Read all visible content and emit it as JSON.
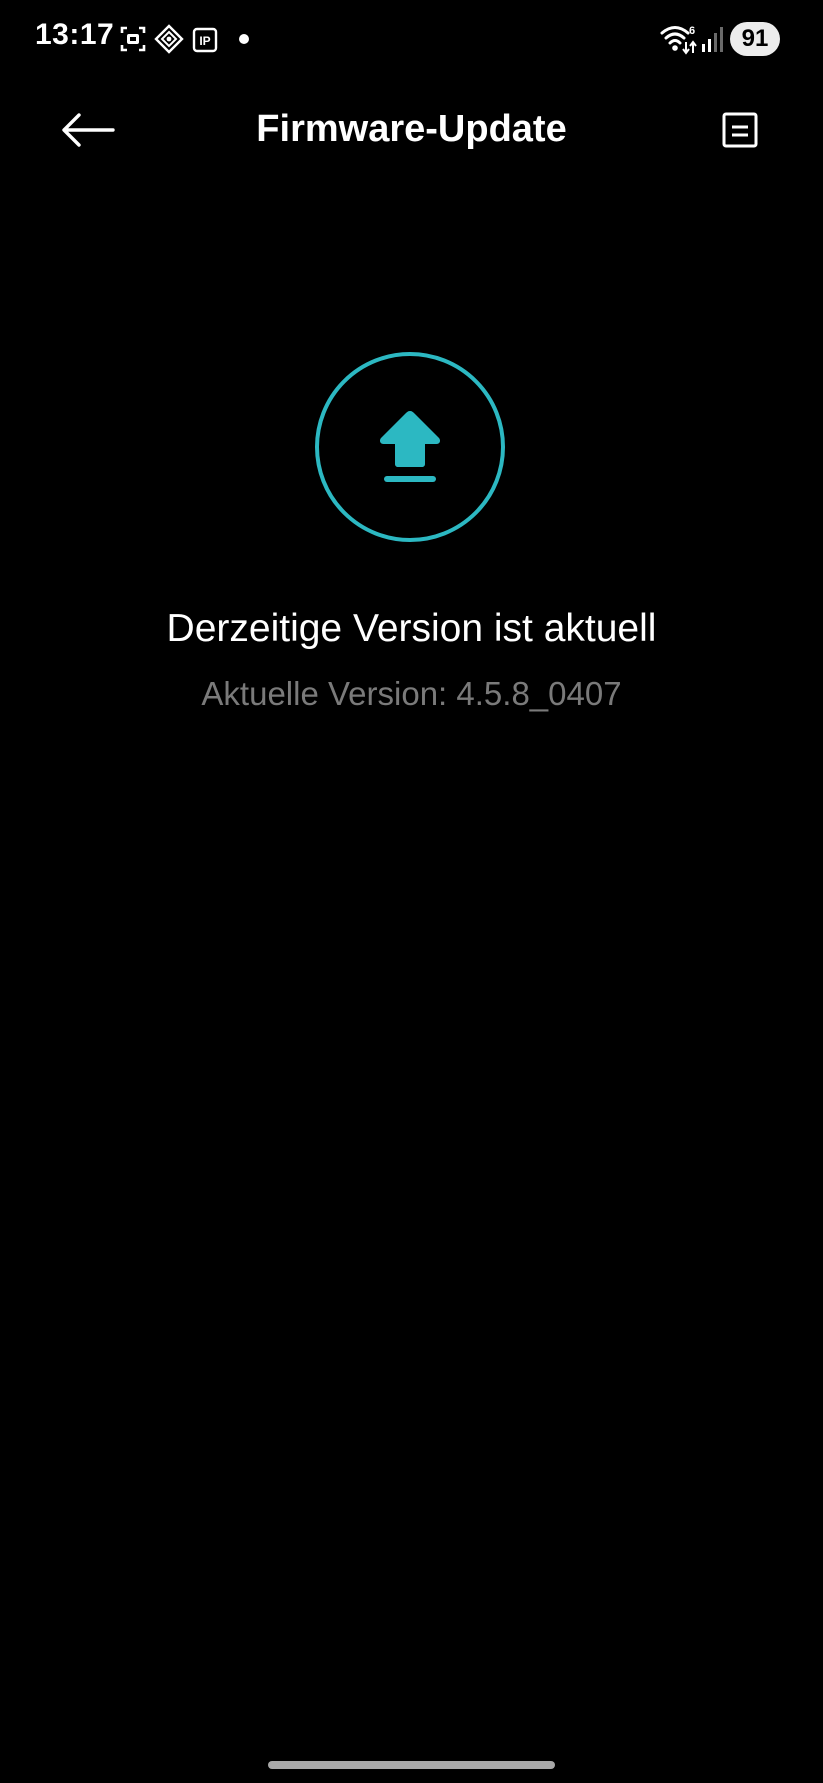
{
  "status_bar": {
    "time": "13:17",
    "left_icons": [
      "screenshot-icon",
      "vpn-diamond-icon",
      "ip-icon",
      "notification-dot"
    ],
    "ip_label": "IP",
    "right_icons": [
      "wifi-icon",
      "signal-icon"
    ],
    "wifi_badge": "6",
    "battery": "91"
  },
  "app_bar": {
    "title": "Firmware-Update",
    "back_icon": "arrow-left-icon",
    "menu_icon": "log-document-icon"
  },
  "main": {
    "status_icon": "upload-arrow-icon",
    "accent_color": "#2cb8c2",
    "status_heading": "Derzeitige Version ist aktuell",
    "version_text": "Aktuelle Version: 4.5.8_0407"
  }
}
